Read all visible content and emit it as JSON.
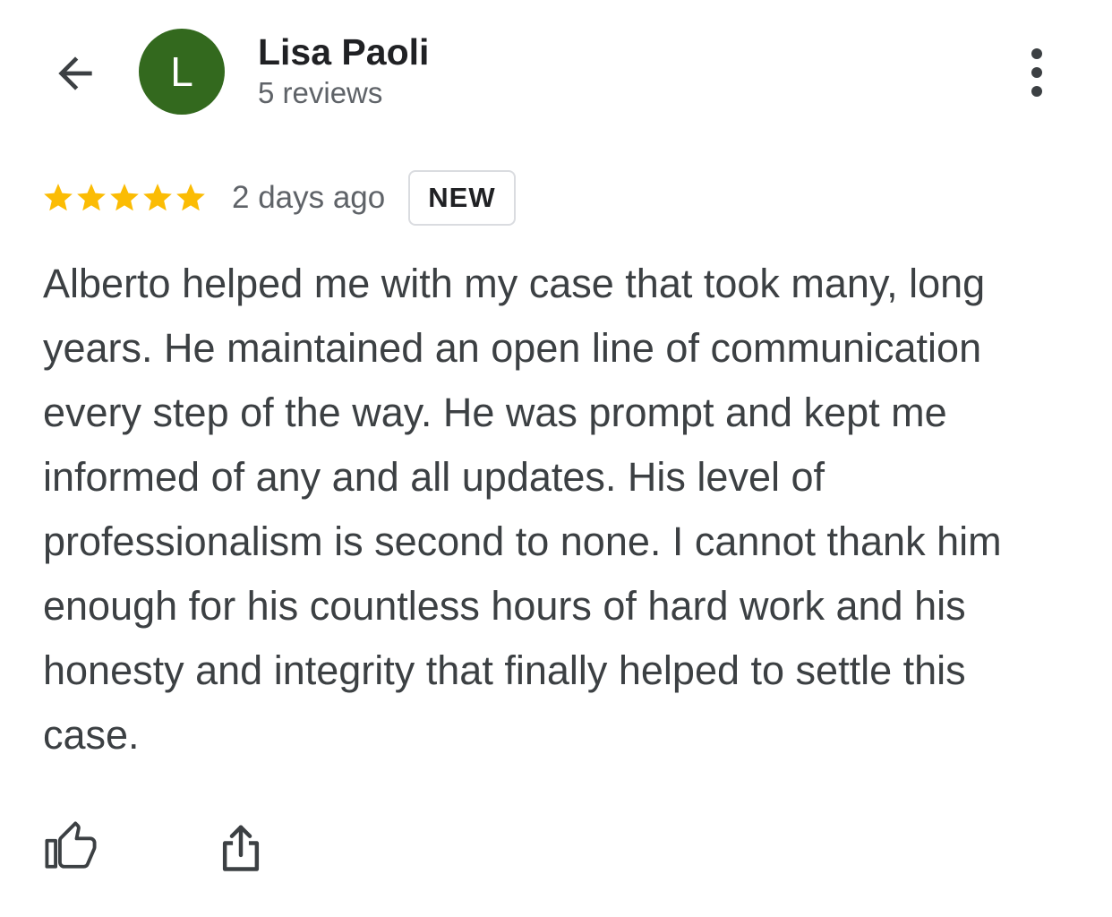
{
  "header": {
    "back_icon": "arrow-back-icon",
    "avatar_initial": "L",
    "avatar_color": "#33691e",
    "reviewer_name": "Lisa Paoli",
    "review_count": "5 reviews",
    "more_icon": "more-vertical-icon"
  },
  "review": {
    "rating": 5,
    "rating_max": 5,
    "star_color": "#fbbc04",
    "date": "2 days ago",
    "badge": "NEW",
    "text": "Alberto helped me with my case that took many, long years. He maintained an open line of communication every step of the way. He was prompt and kept me informed of any and all updates. His level of professionalism is second to none. I cannot thank him enough for his countless hours of hard work and his honesty and integrity that finally helped to settle this case."
  },
  "actions": {
    "like_icon": "thumbs-up-icon",
    "share_icon": "share-icon"
  }
}
